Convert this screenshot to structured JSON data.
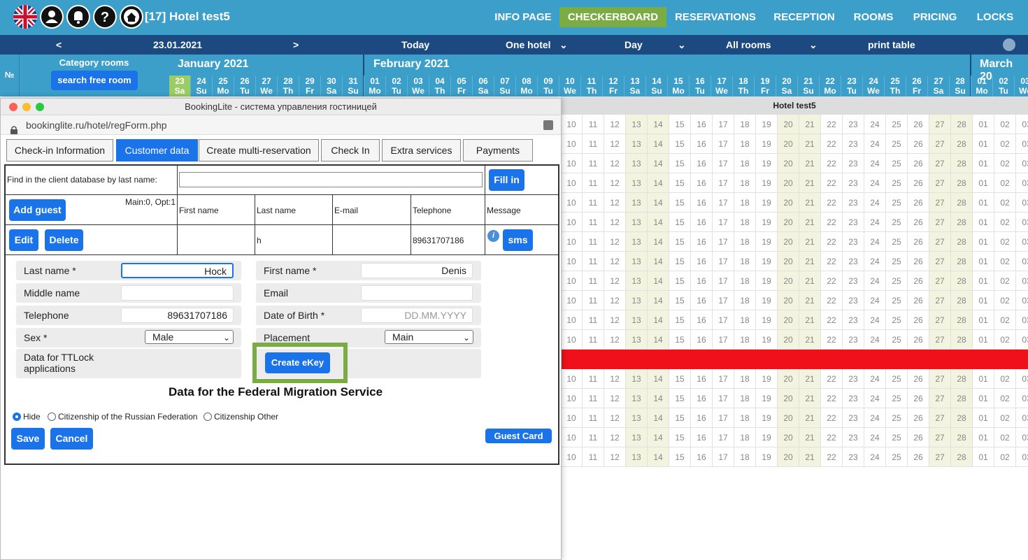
{
  "topbar": {
    "hotel_title": "[17] Hotel test5",
    "icons": [
      "uk-flag-icon",
      "user-icon",
      "bell-icon",
      "help-icon",
      "home-icon"
    ],
    "menu": [
      "INFO PAGE",
      "CHECKERBOARD",
      "RESERVATIONS",
      "RECEPTION",
      "ROOMS",
      "PRICING",
      "LOCKS"
    ],
    "active_menu": "CHECKERBOARD"
  },
  "navbar": {
    "prev": "<",
    "date": "23.01.2021",
    "next": ">",
    "today": "Today",
    "hotel_select": "One hotel",
    "period_select": "Day",
    "rooms_select": "All rooms",
    "print": "print table"
  },
  "checkerboard": {
    "no_header": "№",
    "category_title": "Category rooms",
    "search_free_room": "search free room",
    "months": [
      "January 2021",
      "February 2021",
      "March 20"
    ],
    "days": [
      {
        "d": "23",
        "w": "Sa"
      },
      {
        "d": "24",
        "w": "Su"
      },
      {
        "d": "25",
        "w": "Mo"
      },
      {
        "d": "26",
        "w": "Tu"
      },
      {
        "d": "27",
        "w": "We"
      },
      {
        "d": "28",
        "w": "Th"
      },
      {
        "d": "29",
        "w": "Fr"
      },
      {
        "d": "30",
        "w": "Sa"
      },
      {
        "d": "31",
        "w": "Su"
      },
      {
        "d": "01",
        "w": "Mo"
      },
      {
        "d": "02",
        "w": "Tu"
      },
      {
        "d": "03",
        "w": "We"
      },
      {
        "d": "04",
        "w": "Th"
      },
      {
        "d": "05",
        "w": "Fr"
      },
      {
        "d": "06",
        "w": "Sa"
      },
      {
        "d": "07",
        "w": "Su"
      },
      {
        "d": "08",
        "w": "Mo"
      },
      {
        "d": "09",
        "w": "Tu"
      },
      {
        "d": "10",
        "w": "We"
      },
      {
        "d": "11",
        "w": "Th"
      },
      {
        "d": "12",
        "w": "Fr"
      },
      {
        "d": "13",
        "w": "Sa"
      },
      {
        "d": "14",
        "w": "Su"
      },
      {
        "d": "15",
        "w": "Mo"
      },
      {
        "d": "16",
        "w": "Tu"
      },
      {
        "d": "17",
        "w": "We"
      },
      {
        "d": "18",
        "w": "Th"
      },
      {
        "d": "19",
        "w": "Fr"
      },
      {
        "d": "20",
        "w": "Sa"
      },
      {
        "d": "21",
        "w": "Su"
      },
      {
        "d": "22",
        "w": "Mo"
      },
      {
        "d": "23",
        "w": "Tu"
      },
      {
        "d": "24",
        "w": "We"
      },
      {
        "d": "25",
        "w": "Th"
      },
      {
        "d": "26",
        "w": "Fr"
      },
      {
        "d": "27",
        "w": "Sa"
      },
      {
        "d": "28",
        "w": "Su"
      },
      {
        "d": "01",
        "w": "Mo"
      },
      {
        "d": "02",
        "w": "Tu"
      },
      {
        "d": "03",
        "w": "We"
      }
    ],
    "hotel_row": "Hotel test5",
    "grid_days": [
      "10",
      "11",
      "12",
      "13",
      "14",
      "15",
      "16",
      "17",
      "18",
      "19",
      "20",
      "21",
      "22",
      "23",
      "24",
      "25",
      "26",
      "27",
      "28",
      "01",
      "02",
      "03"
    ]
  },
  "modal": {
    "window_title": "BookingLite - система управления гостиницей",
    "url": "bookinglite.ru/hotel/regForm.php",
    "tabs": [
      "Check-in Information",
      "Customer data",
      "Create multi-reservation",
      "Check In",
      "Extra services",
      "Payments"
    ],
    "active_tab": "Customer data",
    "find_label": "Find in the client database by last name:",
    "fill_in": "Fill in",
    "add_guest": "Add guest",
    "main_opt": "Main:0, Opt:1",
    "headers": [
      "First name",
      "Last name",
      "E-mail",
      "Telephone",
      "Message"
    ],
    "edit": "Edit",
    "delete": "Delete",
    "row": {
      "first_name": "",
      "last_name": "h",
      "email": "",
      "telephone": "89631707186"
    },
    "sms": "sms",
    "form": {
      "last_name_label": "Last name *",
      "last_name_value": "Hock",
      "first_name_label": "First name *",
      "first_name_value": "Denis",
      "middle_name_label": "Middle name",
      "email_label": "Email",
      "telephone_label": "Telephone",
      "telephone_value": "89631707186",
      "dob_label": "Date of Birth *",
      "dob_placeholder": "DD.MM.YYYY",
      "sex_label": "Sex *",
      "sex_value": "Male",
      "placement_label": "Placement",
      "placement_value": "Main",
      "ttlock_label": "Data for TTLock applications",
      "create_ekey": "Create eKey"
    },
    "fms_title": "Data for the Federal Migration Service",
    "radios": [
      "Hide",
      "Citizenship of the Russian Federation",
      "Citizenship Other"
    ],
    "save": "Save",
    "cancel": "Cancel",
    "guest_card": "Guest Card"
  },
  "colors": {
    "topbar": "#3c9fc9",
    "navbar": "#1c4a80",
    "accent_green": "#7aac43",
    "button_blue": "#1a73e8",
    "booking_red": "#f0101a"
  }
}
